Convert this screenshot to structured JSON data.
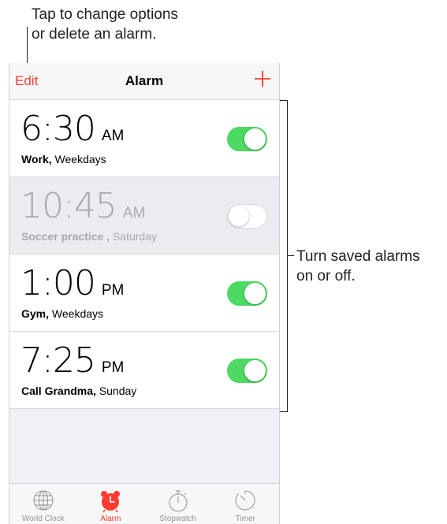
{
  "annotations": {
    "top": [
      "Tap to change options",
      "or delete an alarm."
    ],
    "right": [
      "Turn saved alarms",
      "on or off."
    ]
  },
  "navbar": {
    "edit_label": "Edit",
    "title": "Alarm"
  },
  "alarms": [
    {
      "time": "6:30",
      "ampm": "AM",
      "name": "Work,",
      "repeat": " Weekdays",
      "enabled": true
    },
    {
      "time": "10:45",
      "ampm": "AM",
      "name": "Soccer practice ,",
      "repeat": " Saturday",
      "enabled": false
    },
    {
      "time": "1:00",
      "ampm": "PM",
      "name": "Gym,",
      "repeat": " Weekdays",
      "enabled": true
    },
    {
      "time": "7:25",
      "ampm": "PM",
      "name": "Call Grandma,",
      "repeat": " Sunday",
      "enabled": true
    }
  ],
  "tabbar": {
    "tabs": [
      {
        "label": "World Clock",
        "icon": "globe-icon",
        "active": false
      },
      {
        "label": "Alarm",
        "icon": "alarm-clock-icon",
        "active": true
      },
      {
        "label": "Stopwatch",
        "icon": "stopwatch-icon",
        "active": false
      },
      {
        "label": "Timer",
        "icon": "timer-icon",
        "active": false
      }
    ]
  },
  "colors": {
    "accent": "#ff3b30",
    "toggle_on": "#4cd964"
  }
}
